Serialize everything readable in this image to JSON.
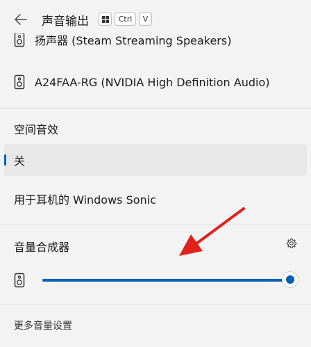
{
  "header": {
    "title": "声音输出",
    "shortcut": {
      "win_key": "win-key-icon",
      "ctrl": "Ctrl",
      "v": "V"
    }
  },
  "devices": [
    {
      "label": "扬声器 (Steam Streaming Speakers)",
      "icon": "speaker-icon"
    },
    {
      "label": "A24FAA-RG (NVIDIA High Definition Audio)",
      "icon": "speaker-icon"
    }
  ],
  "spatial": {
    "title": "空间音效",
    "options": [
      {
        "label": "关",
        "selected": true
      },
      {
        "label": "用于耳机的 Windows Sonic",
        "selected": false
      }
    ]
  },
  "mixer": {
    "title": "音量合成器",
    "settings_icon": "gear-icon",
    "volume_fraction": 1.0,
    "accent": "#005fb8"
  },
  "footer": {
    "more_settings": "更多音量设置"
  },
  "annotation": {
    "arrow_color": "#e0221b"
  }
}
